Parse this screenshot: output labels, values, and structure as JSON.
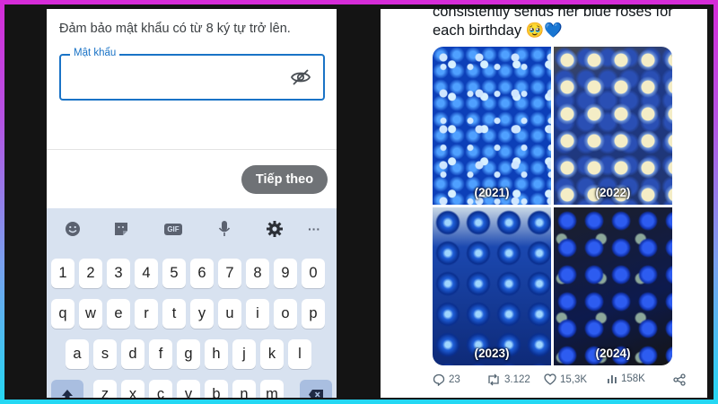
{
  "left_screen": {
    "hint": "Đảm bảo mật khẩu có từ 8 ký tự trở lên.",
    "password_label": "Mật khẩu",
    "password_value": "",
    "next_button": "Tiếp theo",
    "keyboard": {
      "toolbar_icons": [
        "emoji-icon",
        "sticker-icon",
        "gif-icon",
        "microphone-icon",
        "settings-icon",
        "more-icon"
      ],
      "gif_label": "GIF",
      "more_label": "···",
      "row_numbers": [
        "1",
        "2",
        "3",
        "4",
        "5",
        "6",
        "7",
        "8",
        "9",
        "0"
      ],
      "row_top": [
        "q",
        "w",
        "e",
        "r",
        "t",
        "y",
        "u",
        "i",
        "o",
        "p"
      ],
      "row_middle": [
        "a",
        "s",
        "d",
        "f",
        "g",
        "h",
        "j",
        "k",
        "l"
      ],
      "row_bottom": [
        "z",
        "x",
        "c",
        "v",
        "b",
        "n",
        "m"
      ]
    }
  },
  "right_screen": {
    "tweet_text_line1": "consistently sends her blue roses for",
    "tweet_text_line2": "each birthday 🥹💙",
    "photos": [
      {
        "year": "(2021)"
      },
      {
        "year": "(2022)"
      },
      {
        "year": "(2023)"
      },
      {
        "year": "(2024)"
      }
    ],
    "actions": {
      "replies": "23",
      "reposts": "3.122",
      "likes": "15,3K",
      "views": "158K"
    }
  },
  "colors": {
    "accent_blue": "#1a73c6",
    "keyboard_bg": "#d8e2f0",
    "button_gray": "#6f7276"
  }
}
